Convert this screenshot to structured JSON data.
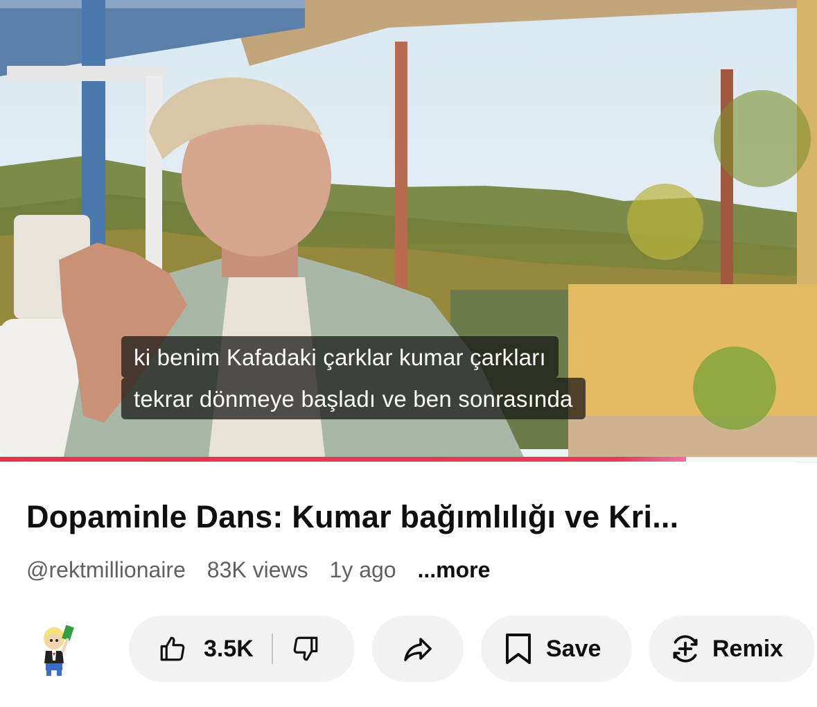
{
  "video": {
    "captions": [
      "ki benim Kafadaki çarklar kumar çarkları",
      "tekrar dönmeye başladı ve ben sonrasında"
    ],
    "progress_fraction": 0.84
  },
  "info": {
    "title": "Dopaminle Dans: Kumar bağımlılığı ve Kri...",
    "channel": "@rektmillionaire",
    "views": "83K views",
    "age": "1y ago",
    "more": "...more"
  },
  "actions": {
    "like_count": "3.5K",
    "save_label": "Save",
    "remix_label": "Remix"
  },
  "icons": {
    "like": "thumbs-up-icon",
    "dislike": "thumbs-down-icon",
    "share": "share-arrow-icon",
    "save": "bookmark-icon",
    "remix": "remix-icon"
  },
  "colors": {
    "progress": "#e3334f",
    "pill_bg": "#f2f2f2",
    "meta_text": "#606060"
  }
}
